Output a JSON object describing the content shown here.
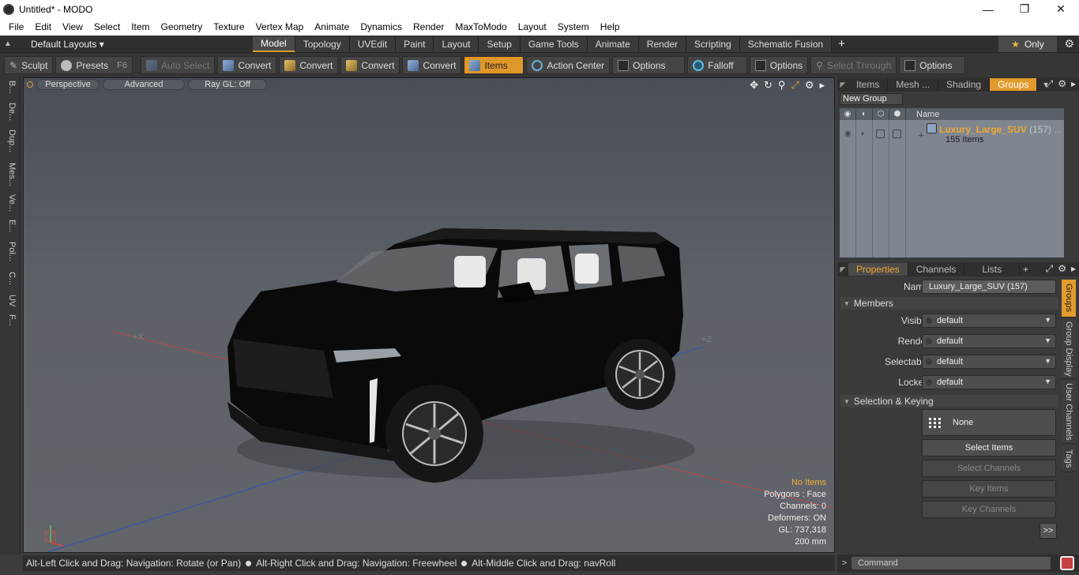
{
  "window": {
    "title": "Untitled* - MODO",
    "controls": [
      "—",
      "❐",
      "✕"
    ]
  },
  "menu": [
    "File",
    "Edit",
    "View",
    "Select",
    "Item",
    "Geometry",
    "Texture",
    "Vertex Map",
    "Animate",
    "Dynamics",
    "Render",
    "MaxToModo",
    "Layout",
    "System",
    "Help"
  ],
  "layoutbar": {
    "layouts_label": "Default Layouts ▾",
    "tabs": [
      "Model",
      "Topology",
      "UVEdit",
      "Paint",
      "Layout",
      "Setup",
      "Game Tools",
      "Animate",
      "Render",
      "Scripting",
      "Schematic Fusion"
    ],
    "active_tab": "Model",
    "only_label": "Only"
  },
  "toolbar": {
    "sculpt": "Sculpt",
    "presets": "Presets",
    "presets_key": "F6",
    "auto_select": "Auto Select",
    "convert": "Convert",
    "items": "Items",
    "action_center": "Action Center",
    "options": "Options",
    "falloff": "Falloff",
    "select_through": "Select Through"
  },
  "leftstrip": [
    "B...",
    "De...",
    "Dup...",
    "Mes...",
    "Ve...",
    "E...",
    "Pol...",
    "C...",
    "UV",
    "F..."
  ],
  "viewport": {
    "perspective": "Perspective",
    "advanced": "Advanced",
    "raygl": "Ray GL: Off",
    "axis_x": "+X",
    "axis_z": "+Z",
    "info": {
      "no_items": "No Items",
      "polygons": "Polygons : Face",
      "channels": "Channels: 0",
      "deformers": "Deformers: ON",
      "gl": "GL: 737,318",
      "scale": "200 mm"
    }
  },
  "status": {
    "hint1": "Alt-Left Click and Drag: Navigation: Rotate (or Pan)",
    "hint2": "Alt-Right Click and Drag: Navigation: Freewheel",
    "hint3": "Alt-Middle Click and Drag: navRoll"
  },
  "groups_panel": {
    "tabs": [
      "Items",
      "Mesh ...",
      "Shading",
      "Groups"
    ],
    "active_tab": "Groups",
    "new_group": "New Group",
    "name_header": "Name",
    "group": {
      "name": "Luxury_Large_SUV",
      "count": "(157) ...",
      "sub": "155 Items"
    }
  },
  "properties_panel": {
    "tabs": [
      "Properties",
      "Channels",
      "Lists"
    ],
    "active_tab": "Properties",
    "name_label": "Name",
    "name_value": "Luxury_Large_SUV (157)",
    "members_section": "Members",
    "fields": [
      {
        "label": "Visible",
        "value": "default"
      },
      {
        "label": "Render",
        "value": "default"
      },
      {
        "label": "Selectable",
        "value": "default"
      },
      {
        "label": "Locked",
        "value": "default"
      }
    ],
    "sel_section": "Selection & Keying",
    "none_btn": "None",
    "select_items": "Select Items",
    "select_channels": "Select Channels",
    "key_items": "Key Items",
    "key_channels": "Key Channels",
    "more": ">>",
    "side_tabs": [
      "Groups",
      "Group Display",
      "User Channels",
      "Tags"
    ]
  },
  "command": {
    "placeholder": "Command"
  },
  "colors": {
    "accent": "#e29b2c",
    "group_name": "#f0a830",
    "info_yellow": "#f0b030"
  }
}
